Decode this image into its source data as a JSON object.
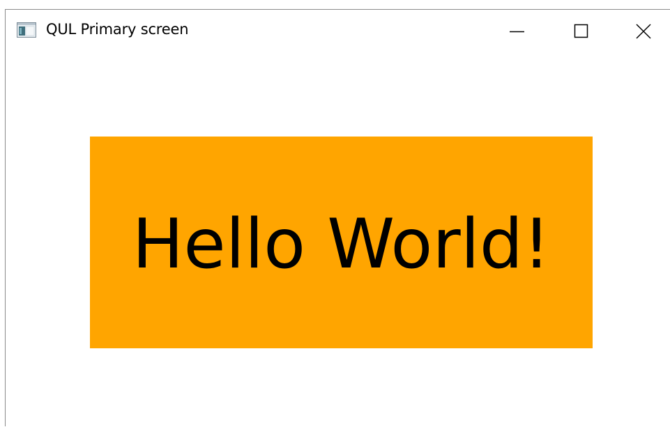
{
  "window": {
    "title": "QUL Primary screen",
    "icon": "application-window-icon",
    "controls": {
      "minimize": "minimize-icon",
      "maximize": "maximize-icon",
      "close": "close-icon"
    }
  },
  "main": {
    "panel_text": "Hello World!",
    "panel_color": "#ffa500",
    "background_color": "#ffffff"
  }
}
